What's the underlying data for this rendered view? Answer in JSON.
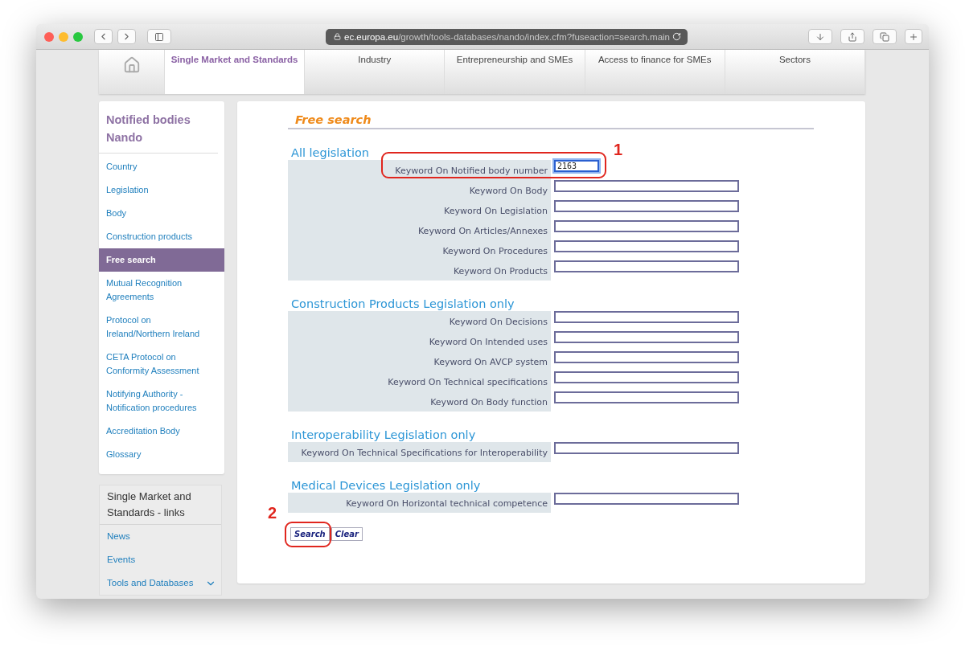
{
  "browser": {
    "url_host": "ec.europa.eu",
    "url_path": "/growth/tools-databases/nando/index.cfm?fuseaction=search.main"
  },
  "nav": {
    "tabs": [
      {
        "label": "Single Market and Standards",
        "selected": true
      },
      {
        "label": "Industry",
        "selected": false
      },
      {
        "label": "Entrepreneurship and SMEs",
        "selected": false
      },
      {
        "label": "Access to finance for SMEs",
        "selected": false
      },
      {
        "label": "Sectors",
        "selected": false
      }
    ]
  },
  "sidebar": {
    "title": "Notified bodies Nando",
    "items": [
      {
        "label": "Country",
        "selected": false
      },
      {
        "label": "Legislation",
        "selected": false
      },
      {
        "label": "Body",
        "selected": false
      },
      {
        "label": "Construction products",
        "selected": false
      },
      {
        "label": "Free search",
        "selected": true
      },
      {
        "label": "Mutual Recognition Agreements",
        "selected": false
      },
      {
        "label": "Protocol on Ireland/Northern Ireland",
        "selected": false
      },
      {
        "label": "CETA Protocol on Conformity Assessment",
        "selected": false
      },
      {
        "label": "Notifying Authority - Notification procedures",
        "selected": false
      },
      {
        "label": "Accreditation Body",
        "selected": false
      },
      {
        "label": "Glossary",
        "selected": false
      }
    ]
  },
  "links_panel": {
    "title": "Single Market and Standards - links",
    "items": [
      {
        "label": "News",
        "kind": "link"
      },
      {
        "label": "Events",
        "kind": "link"
      },
      {
        "label": "Tools and Databases",
        "kind": "dropdown"
      }
    ]
  },
  "form": {
    "title": "Free search",
    "sections": [
      {
        "heading": "All legislation",
        "fields": [
          {
            "label": "Keyword On Notified body number",
            "kind": "short",
            "value": "2163",
            "focused": true,
            "callout": "1"
          },
          {
            "label": "Keyword On Body",
            "kind": "wide",
            "focused": false
          },
          {
            "label": "Keyword On Legislation",
            "kind": "wide",
            "focused": false
          },
          {
            "label": "Keyword On Articles/Annexes",
            "kind": "wide",
            "focused": false
          },
          {
            "label": "Keyword On Procedures",
            "kind": "wide",
            "focused": false
          },
          {
            "label": "Keyword On Products",
            "kind": "wide",
            "focused": false
          }
        ]
      },
      {
        "heading": "Construction Products Legislation only",
        "fields": [
          {
            "label": "Keyword On Decisions",
            "kind": "wide",
            "focused": false
          },
          {
            "label": "Keyword On Intended uses",
            "kind": "wide",
            "focused": false
          },
          {
            "label": "Keyword On AVCP system",
            "kind": "wide",
            "focused": false
          },
          {
            "label": "Keyword On Technical specifications",
            "kind": "wide",
            "focused": false
          },
          {
            "label": "Keyword On Body function",
            "kind": "wide",
            "focused": false
          }
        ]
      },
      {
        "heading": "Interoperability Legislation only",
        "fields": [
          {
            "label": "Keyword On Technical Specifications for Interoperability",
            "kind": "wide",
            "focused": false
          }
        ]
      },
      {
        "heading": "Medical Devices Legislation only",
        "fields": [
          {
            "label": "Keyword On Horizontal technical competence",
            "kind": "wide",
            "focused": false
          }
        ]
      }
    ],
    "buttons": [
      {
        "label": "Search",
        "callout": "2"
      },
      {
        "label": "Clear"
      }
    ]
  }
}
